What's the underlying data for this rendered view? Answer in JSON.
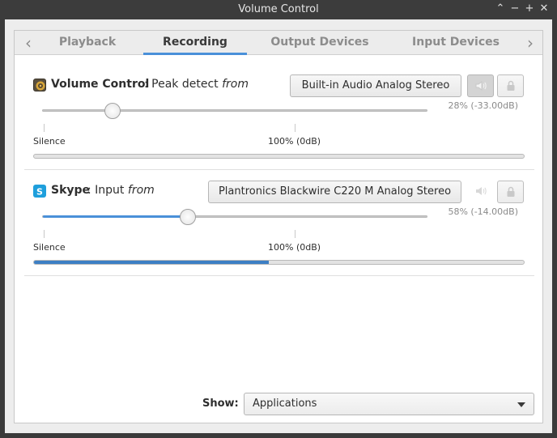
{
  "window": {
    "title": "Volume Control"
  },
  "titlebar_buttons": {
    "up": "⌃",
    "minimize": "−",
    "maximize": "+",
    "close": "✕"
  },
  "tabs": [
    {
      "label": "Playback",
      "active": false
    },
    {
      "label": "Recording",
      "active": true
    },
    {
      "label": "Output Devices",
      "active": false
    },
    {
      "label": "Input Devices",
      "active": false
    }
  ],
  "streams": [
    {
      "name": "Volume Control",
      "separator": " : ",
      "description": "Peak detect",
      "from": "from",
      "icon": "audio-speaker-icon",
      "device": "Built-in Audio Analog Stereo",
      "volume_text": "28% (-33.00dB)",
      "volume_fraction": 0.28,
      "mute_pressed": true,
      "silence_label": "Silence",
      "full_label": "100% (0dB)",
      "meter_level": 0.0
    },
    {
      "name": "Skype",
      "separator": " : ",
      "description": "Input",
      "from": "from",
      "icon": "skype-icon",
      "device": "Plantronics Blackwire C220 M Analog Stereo",
      "volume_text": "58% (-14.00dB)",
      "volume_fraction": 0.58,
      "mute_pressed": false,
      "silence_label": "Silence",
      "full_label": "100% (0dB)",
      "meter_level": 0.48
    }
  ],
  "footer": {
    "show_label": "Show:",
    "show_value": "Applications"
  },
  "colors": {
    "accent": "#4a90d9",
    "meter": "#3d7fc4"
  }
}
